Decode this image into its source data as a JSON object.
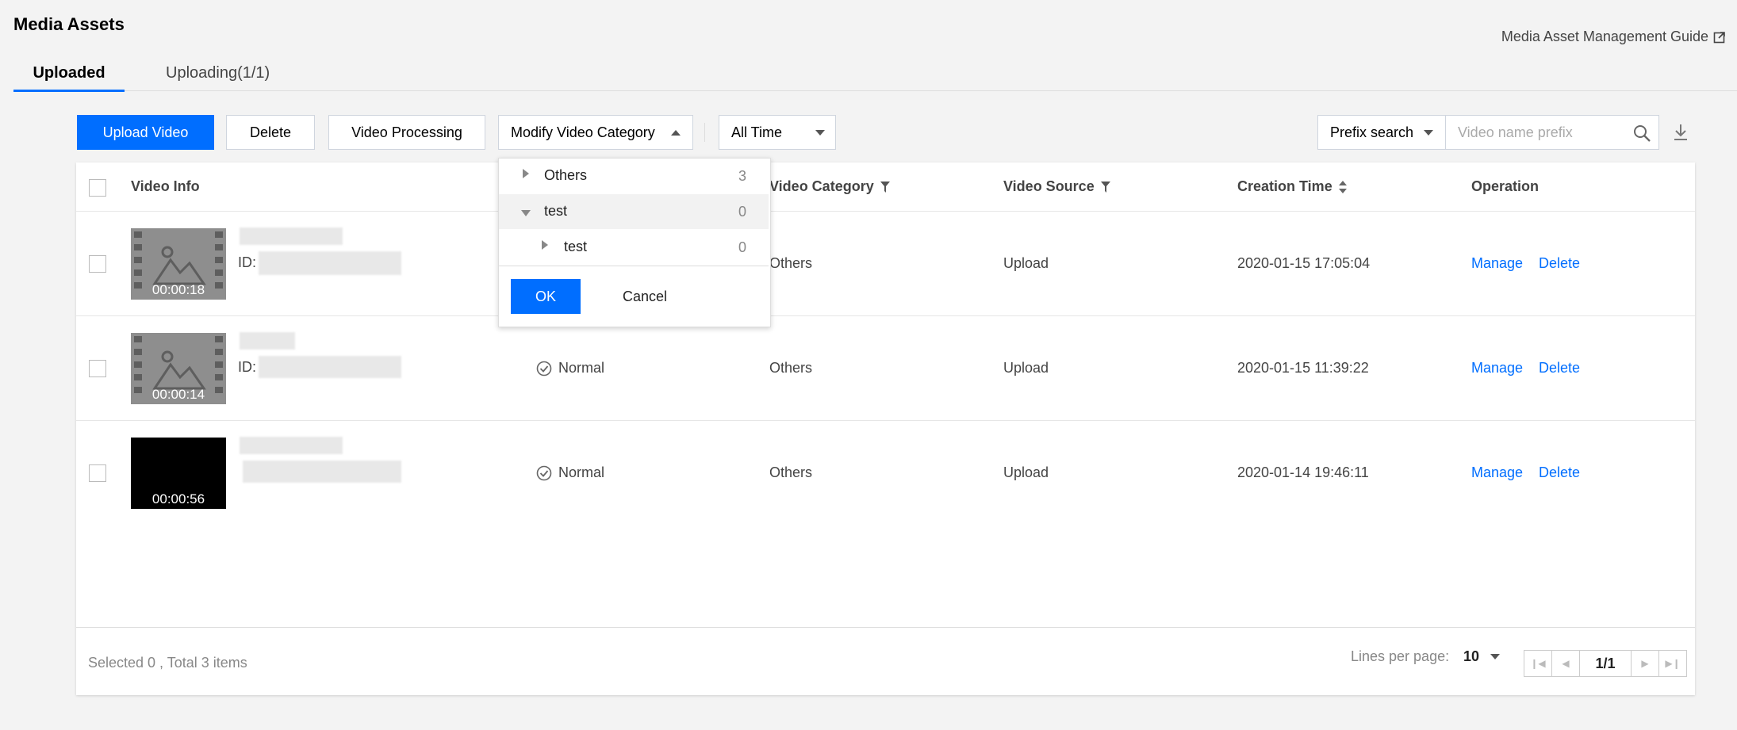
{
  "page": {
    "title": "Media Assets",
    "guide_link": "Media Asset Management Guide"
  },
  "tabs": [
    {
      "label": "Uploaded"
    },
    {
      "label": "Uploading(1/1)"
    }
  ],
  "toolbar": {
    "upload": "Upload Video",
    "delete": "Delete",
    "processing": "Video Processing",
    "modify_category": "Modify Video Category",
    "time_filter": "All Time",
    "search_mode": "Prefix search",
    "search_placeholder": "Video name prefix"
  },
  "table": {
    "headers": {
      "video_info": "Video Info",
      "category": "Video Category",
      "source": "Video Source",
      "created": "Creation Time",
      "operation": "Operation"
    },
    "rows": [
      {
        "duration": "00:00:18",
        "id_label": "ID:",
        "status": "",
        "category": "Others",
        "source": "Upload",
        "created": "2020-01-15 17:05:04",
        "manage": "Manage",
        "delete": "Delete"
      },
      {
        "duration": "00:00:14",
        "id_label": "ID:",
        "status": "Normal",
        "category": "Others",
        "source": "Upload",
        "created": "2020-01-15 11:39:22",
        "manage": "Manage",
        "delete": "Delete"
      },
      {
        "duration": "00:00:56",
        "id_label": "",
        "status": "Normal",
        "category": "Others",
        "source": "Upload",
        "created": "2020-01-14 19:46:11",
        "manage": "Manage",
        "delete": "Delete"
      }
    ]
  },
  "footer": {
    "selection": "Selected 0 , Total 3 items",
    "lines_label": "Lines per page:",
    "lines_value": "10",
    "page": "1/1"
  },
  "category_dropdown": {
    "items": [
      {
        "label": "Others",
        "count": "3"
      },
      {
        "label": "test",
        "count": "0"
      },
      {
        "label": "test",
        "count": "0"
      }
    ],
    "ok": "OK",
    "cancel": "Cancel"
  },
  "colors": {
    "primary": "#006eff",
    "background": "#f3f3f3"
  }
}
